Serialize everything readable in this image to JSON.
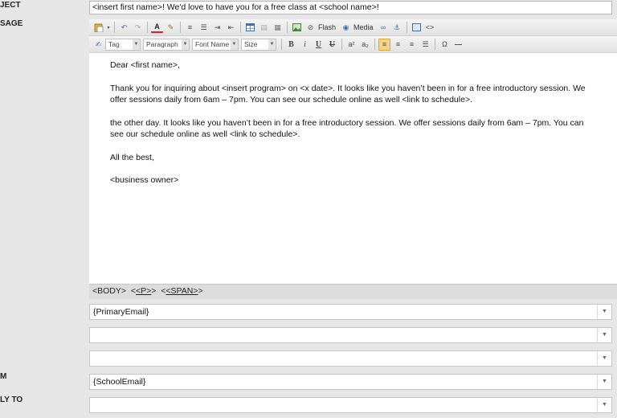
{
  "labels": {
    "subject": "JECT",
    "message": "SAGE",
    "from": "M",
    "reply_to": "LY TO"
  },
  "subject_value": "<insert first name>! We'd love to have you for a free class at <school name>!",
  "toolbar": {
    "flash_label": "Flash",
    "media_label": "Media",
    "tag_placeholder": "Tag",
    "paragraph_label": "Paragraph",
    "font_name_label": "Font Name",
    "size_label": "Size"
  },
  "body": {
    "greeting": "Dear <first name>,",
    "p1_line1": "Thank you for inquiring about  <insert program> on <x date>. It looks like you haven’t been in for a free introductory session. We",
    "p1_line2": "offer sessions daily from 6am – 7pm. You can see our schedule online as well <link to schedule>.",
    "p2_line1": "the other day. It looks like you haven’t been in for a free introductory session. We offer sessions daily from 6am – 7pm. You can",
    "p2_line2": "see our schedule online as well <link to schedule>.",
    "closing": "All the best,",
    "signature": "<business owner>"
  },
  "path": {
    "body": "<BODY>",
    "p": "<P>",
    "span": "<SPAN>"
  },
  "fields": {
    "to": "{PrimaryEmail}",
    "cc": "",
    "bcc": "",
    "from": "{SchoolEmail}",
    "reply_to": ""
  }
}
